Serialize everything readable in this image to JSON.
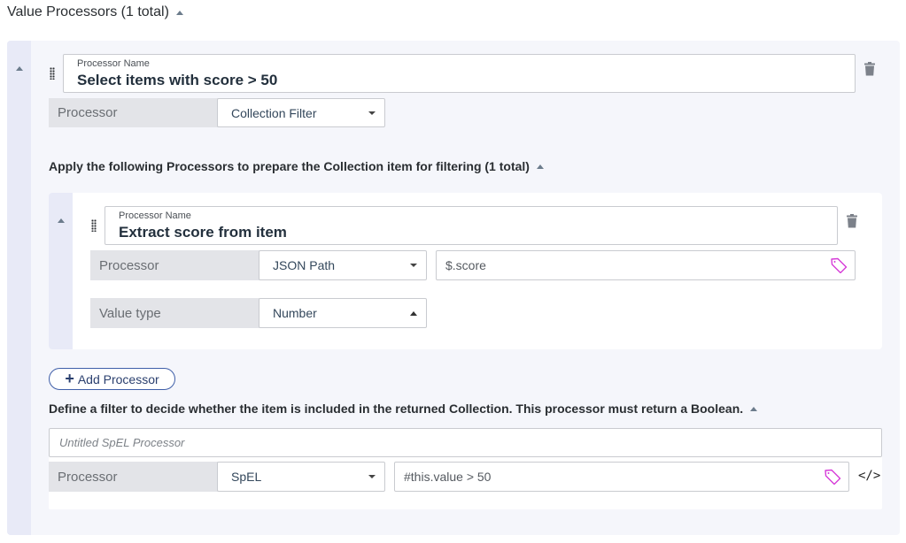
{
  "header": {
    "title": "Value Processors (1 total)"
  },
  "processor": {
    "name_label": "Processor Name",
    "name_value": "Select items with score > 50",
    "type_label": "Processor",
    "type_value": "Collection Filter"
  },
  "prepare_section": {
    "heading": "Apply the following Processors to prepare the Collection item for filtering (1 total)",
    "sub_processor": {
      "name_label": "Processor Name",
      "name_value": "Extract score from item",
      "type_label": "Processor",
      "type_value": "JSON Path",
      "expression_value": "$.score",
      "value_type_label": "Value type",
      "value_type_value": "Number"
    },
    "add_button_label": "Add Processor",
    "add_button_icon": "+"
  },
  "filter_section": {
    "heading": "Define a filter to decide whether the item is included in the returned Collection. This processor must return a Boolean.",
    "name_placeholder": "Untitled SpEL Processor",
    "type_label": "Processor",
    "type_value": "SpEL",
    "expression_value": "#this.value > 50",
    "code_icon_glyph": "</>"
  },
  "colors": {
    "tag_icon": "#d63bd8",
    "trash_icon": "#7c818a",
    "add_button_border": "#3e5ea8"
  }
}
